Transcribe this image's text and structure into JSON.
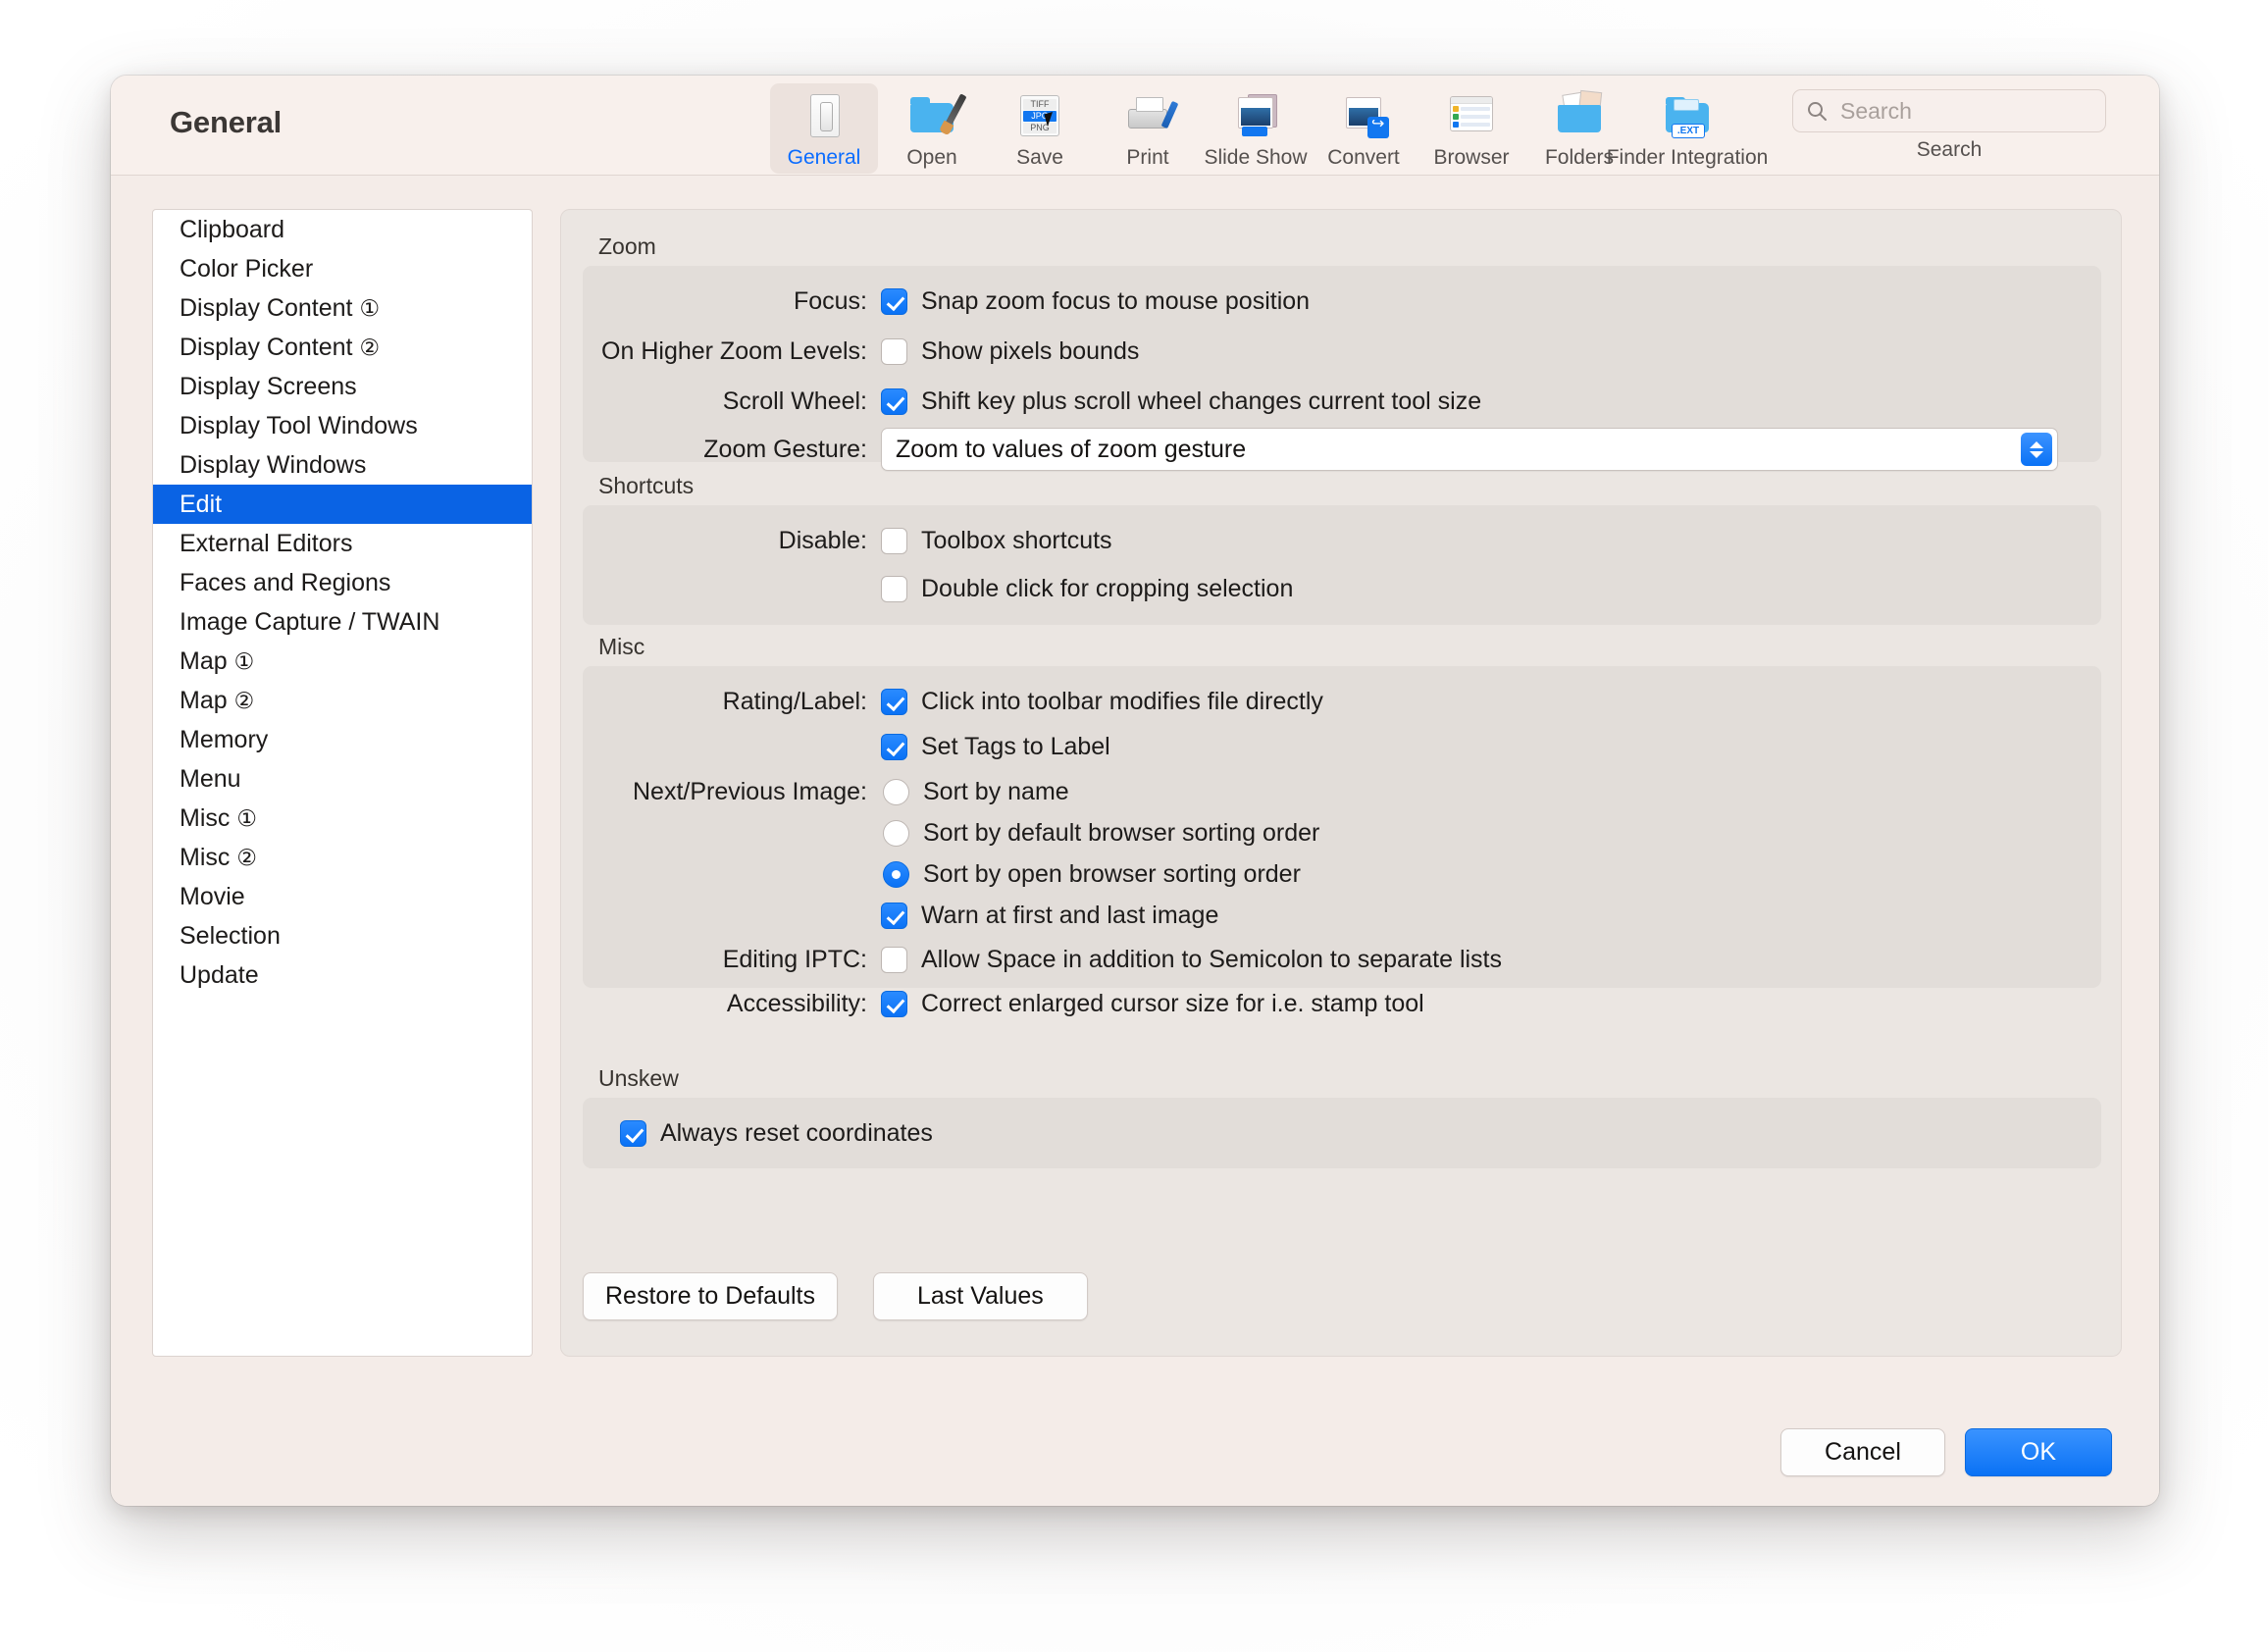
{
  "window": {
    "title": "General"
  },
  "toolbar": {
    "items": [
      {
        "label": "General",
        "icon": "switch-icon",
        "selected": true
      },
      {
        "label": "Open",
        "icon": "folder-brush-icon",
        "selected": false
      },
      {
        "label": "Save",
        "icon": "file-formats-icon",
        "selected": false
      },
      {
        "label": "Print",
        "icon": "printer-icon",
        "selected": false
      },
      {
        "label": "Slide Show",
        "icon": "slideshow-icon",
        "selected": false
      },
      {
        "label": "Convert",
        "icon": "convert-icon",
        "selected": false
      },
      {
        "label": "Browser",
        "icon": "browser-window-icon",
        "selected": false
      },
      {
        "label": "Folders",
        "icon": "folders-photos-icon",
        "selected": false
      },
      {
        "label": "Finder Integration",
        "icon": "folder-ext-icon",
        "selected": false
      }
    ],
    "format_icon_labels": [
      "TIFF",
      "JPG",
      "PNG"
    ],
    "ext_badge": ".EXT"
  },
  "search": {
    "value": "",
    "placeholder": "Search",
    "caption": "Search"
  },
  "sidebar": {
    "items": [
      {
        "label": "Clipboard",
        "badge": "",
        "active": false
      },
      {
        "label": "Color Picker",
        "badge": "",
        "active": false
      },
      {
        "label": "Display Content",
        "badge": "①",
        "active": false
      },
      {
        "label": "Display Content",
        "badge": "②",
        "active": false
      },
      {
        "label": "Display Screens",
        "badge": "",
        "active": false
      },
      {
        "label": "Display Tool Windows",
        "badge": "",
        "active": false
      },
      {
        "label": "Display Windows",
        "badge": "",
        "active": false
      },
      {
        "label": "Edit",
        "badge": "",
        "active": true
      },
      {
        "label": "External Editors",
        "badge": "",
        "active": false
      },
      {
        "label": "Faces and Regions",
        "badge": "",
        "active": false
      },
      {
        "label": "Image Capture / TWAIN",
        "badge": "",
        "active": false
      },
      {
        "label": "Map",
        "badge": "①",
        "active": false
      },
      {
        "label": "Map",
        "badge": "②",
        "active": false
      },
      {
        "label": "Memory",
        "badge": "",
        "active": false
      },
      {
        "label": "Menu",
        "badge": "",
        "active": false
      },
      {
        "label": "Misc",
        "badge": "①",
        "active": false
      },
      {
        "label": "Misc",
        "badge": "②",
        "active": false
      },
      {
        "label": "Movie",
        "badge": "",
        "active": false
      },
      {
        "label": "Selection",
        "badge": "",
        "active": false
      },
      {
        "label": "Update",
        "badge": "",
        "active": false
      }
    ]
  },
  "panel": {
    "zoom": {
      "title": "Zoom",
      "focus_label": "Focus:",
      "focus_option": "Snap zoom focus to mouse position",
      "focus_checked": true,
      "higher_label": "On Higher Zoom Levels:",
      "higher_option": "Show pixels bounds",
      "higher_checked": false,
      "scroll_label": "Scroll Wheel:",
      "scroll_option": "Shift key plus scroll wheel changes current tool size",
      "scroll_checked": true,
      "gesture_label": "Zoom Gesture:",
      "gesture_value": "Zoom to values of zoom gesture"
    },
    "shortcuts": {
      "title": "Shortcuts",
      "disable_label": "Disable:",
      "option1": "Toolbox shortcuts",
      "option1_checked": false,
      "option2": "Double click for cropping selection",
      "option2_checked": false
    },
    "misc": {
      "title": "Misc",
      "rating_label": "Rating/Label:",
      "rating_option1": "Click into toolbar modifies file directly",
      "rating_option1_checked": true,
      "rating_option2": "Set Tags to Label",
      "rating_option2_checked": true,
      "nextprev_label": "Next/Previous Image:",
      "nextprev_radio1": "Sort by name",
      "nextprev_radio1_selected": false,
      "nextprev_radio2": "Sort by default browser sorting order",
      "nextprev_radio2_selected": false,
      "nextprev_radio3": "Sort by open browser sorting order",
      "nextprev_radio3_selected": true,
      "nextprev_check": "Warn at first and last image",
      "nextprev_check_checked": true,
      "iptc_label": "Editing IPTC:",
      "iptc_option": "Allow Space in addition to Semicolon to separate lists",
      "iptc_checked": false,
      "accessibility_label": "Accessibility:",
      "accessibility_option": "Correct enlarged cursor size for i.e. stamp tool",
      "accessibility_checked": true
    },
    "unskew": {
      "title": "Unskew",
      "option": "Always reset coordinates",
      "checked": true
    },
    "restore_button": "Restore to Defaults",
    "lastvalues_button": "Last Values"
  },
  "footer": {
    "cancel": "Cancel",
    "ok": "OK"
  },
  "colors": {
    "accent": "#0a72f5",
    "selection": "#0a63e4",
    "window_bg": "#f6eeea",
    "panel_bg": "#ebe6e2",
    "group_bg": "#e2ddd9"
  }
}
